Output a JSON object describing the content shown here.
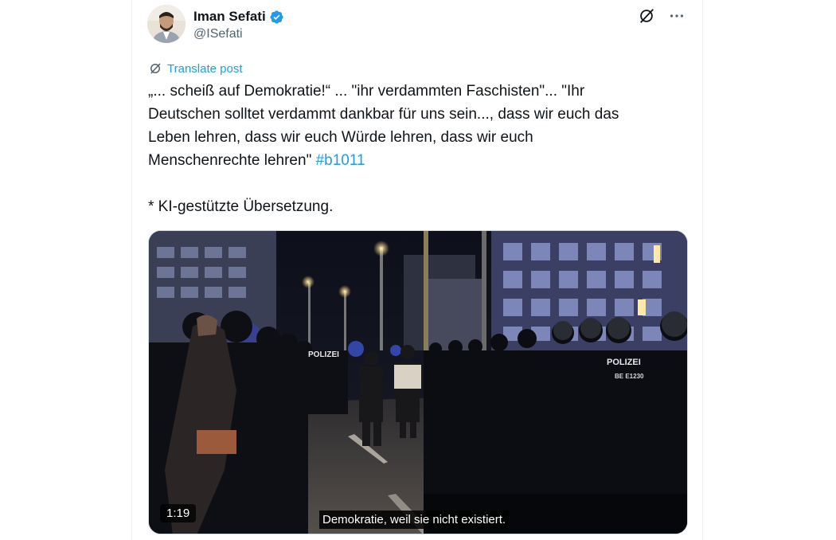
{
  "author": {
    "display_name": "Iman Sefati",
    "handle": "@ISefati",
    "verified": true
  },
  "actions": {
    "grok_icon": "grok-icon",
    "more_icon": "more-icon"
  },
  "translate": {
    "label": "Translate post"
  },
  "post": {
    "line1": "„... scheiß auf Demokratie!“ ... \"ihr verdammten Faschisten\"... \"Ihr",
    "line2": "Deutschen solltet verdammt dankbar für uns sein..., dass wir euch das",
    "line3": "Leben lehren, dass wir euch Würde lehren, dass wir euch",
    "line4": "Menschenrechte lehren\"",
    "hashtag": "#b1011",
    "footnote": "* KI-gestützte Übersetzung."
  },
  "video": {
    "duration": "1:19",
    "subtitle": "Demokratie, weil sie nicht existiert.",
    "police_label_left": "POLIZEI",
    "police_label_right": "POLIZEI",
    "badge_right": "BE E1230"
  },
  "colors": {
    "accent": "#1d9bf0",
    "text": "#0f1419",
    "secondary": "#536471"
  }
}
